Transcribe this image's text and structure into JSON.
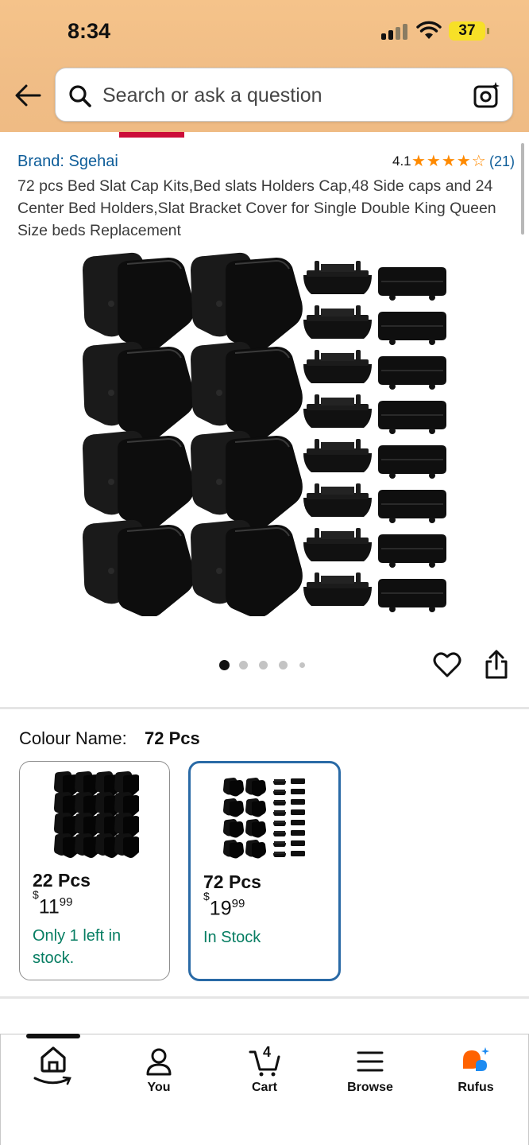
{
  "status_bar": {
    "time": "8:34",
    "battery": "37"
  },
  "search": {
    "placeholder": "Search or ask a question"
  },
  "product": {
    "brand": "Brand: Sgehai",
    "rating": "4.1",
    "rating_stars": 4.1,
    "stars_text": "★★★★☆",
    "rating_count": "(21)",
    "title": "72 pcs Bed Slat Cap Kits,Bed slats Holders Cap,48 Side caps and 24 Center Bed Holders,Slat Bracket Cover for Single Double King Queen Size beds Replacement",
    "image_count": 5,
    "active_image_index": 0
  },
  "colour": {
    "label": "Colour Name:",
    "selected": "72 Pcs",
    "options": [
      {
        "name": "22 Pcs",
        "price_symbol": "$",
        "price_whole": "11",
        "price_cents": "99",
        "stock": "Only 1 left in stock.",
        "selected": false
      },
      {
        "name": "72 Pcs",
        "price_symbol": "$",
        "price_whole": "19",
        "price_cents": "99",
        "stock": "In Stock",
        "selected": true
      }
    ]
  },
  "bottom_nav": {
    "items": [
      {
        "label": "",
        "icon": "home-icon"
      },
      {
        "label": "You",
        "icon": "user-icon"
      },
      {
        "label": "Cart",
        "icon": "cart-icon",
        "badge": "4"
      },
      {
        "label": "Browse",
        "icon": "menu-icon"
      },
      {
        "label": "Rufus",
        "icon": "rufus-icon"
      }
    ]
  },
  "colors": {
    "header_bg": "#f0bd86",
    "link_blue": "#0e5d99",
    "star_orange": "#ff8a00",
    "stock_green": "#067d62",
    "selected_border": "#2a6aa6",
    "rufus_orange": "#ff6200",
    "rufus_blue": "#1d8bf1"
  }
}
